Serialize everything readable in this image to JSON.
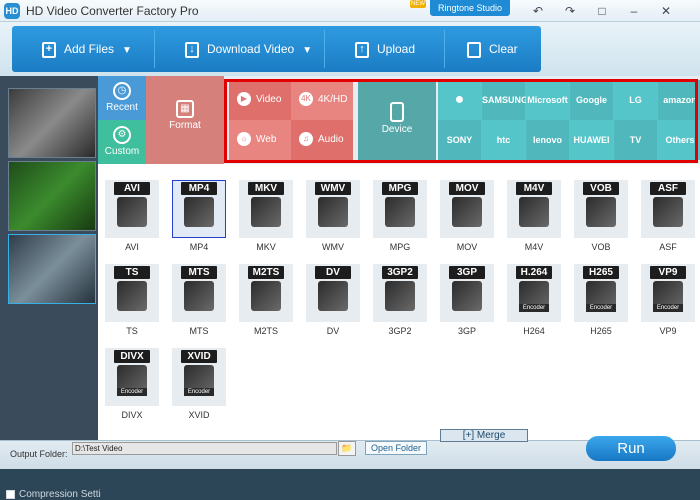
{
  "title_bar": {
    "app_icon_letters": "HD",
    "title": "HD Video Converter Factory Pro",
    "new_badge": "NEW",
    "ringtone_label": "Ringtone Studio",
    "buttons": [
      "undo-icon",
      "redo-icon",
      "chat-icon",
      "minimize-icon",
      "close-icon"
    ]
  },
  "toolbar": {
    "add_files": "Add Files",
    "download_video": "Download Video",
    "upload": "Upload",
    "clear": "Clear"
  },
  "left_panel": {
    "compression_label": "Compression Setti"
  },
  "categories": {
    "recent": "Recent",
    "custom": "Custom",
    "format": "Format",
    "video": "Video",
    "hd": "4K/HD",
    "web": "Web",
    "audio": "Audio",
    "device": "Device",
    "brands_row1": [
      "",
      "SAMSUNG",
      "Microsoft",
      "Google",
      "LG",
      "amazon"
    ],
    "brands_row2": [
      "SONY",
      "htc",
      "lenovo",
      "HUAWEI",
      "TV",
      "Others"
    ]
  },
  "formats": [
    {
      "badge": "AVI",
      "name": "AVI"
    },
    {
      "badge": "MP4",
      "name": "MP4",
      "selected": true
    },
    {
      "badge": "MKV",
      "name": "MKV"
    },
    {
      "badge": "WMV",
      "name": "WMV"
    },
    {
      "badge": "MPG",
      "name": "MPG"
    },
    {
      "badge": "MOV",
      "name": "MOV"
    },
    {
      "badge": "M4V",
      "name": "M4V"
    },
    {
      "badge": "VOB",
      "name": "VOB"
    },
    {
      "badge": "ASF",
      "name": "ASF"
    },
    {
      "badge": "TS",
      "name": "TS"
    },
    {
      "badge": "MTS",
      "name": "MTS"
    },
    {
      "badge": "M2TS",
      "name": "M2TS"
    },
    {
      "badge": "DV",
      "name": "DV"
    },
    {
      "badge": "3GP2",
      "name": "3GP2"
    },
    {
      "badge": "3GP",
      "name": "3GP"
    },
    {
      "badge": "H.264",
      "name": "H264",
      "encoder": "Encoder"
    },
    {
      "badge": "H265",
      "name": "H265",
      "encoder": "Encoder"
    },
    {
      "badge": "VP9",
      "name": "VP9",
      "encoder": "Encoder"
    },
    {
      "badge": "DIVX",
      "name": "DIVX",
      "encoder": "Encoder"
    },
    {
      "badge": "XVID",
      "name": "XVID",
      "encoder": "Encoder"
    }
  ],
  "bottom": {
    "output_label": "Output Folder:",
    "output_value": "D:\\Test Video",
    "open_folder": "Open Folder",
    "merge": "Merge",
    "run": "Run"
  },
  "colors": {
    "toolbar_blue": "#1e86cf",
    "recent_blue": "#4a9ad8",
    "custom_green": "#3fbf9e",
    "format_pink": "#d6807c",
    "device_teal": "#56a8a8",
    "brand_teal": "#56c5c9",
    "highlight_red": "#e00000",
    "selected_border": "#2541c9"
  }
}
